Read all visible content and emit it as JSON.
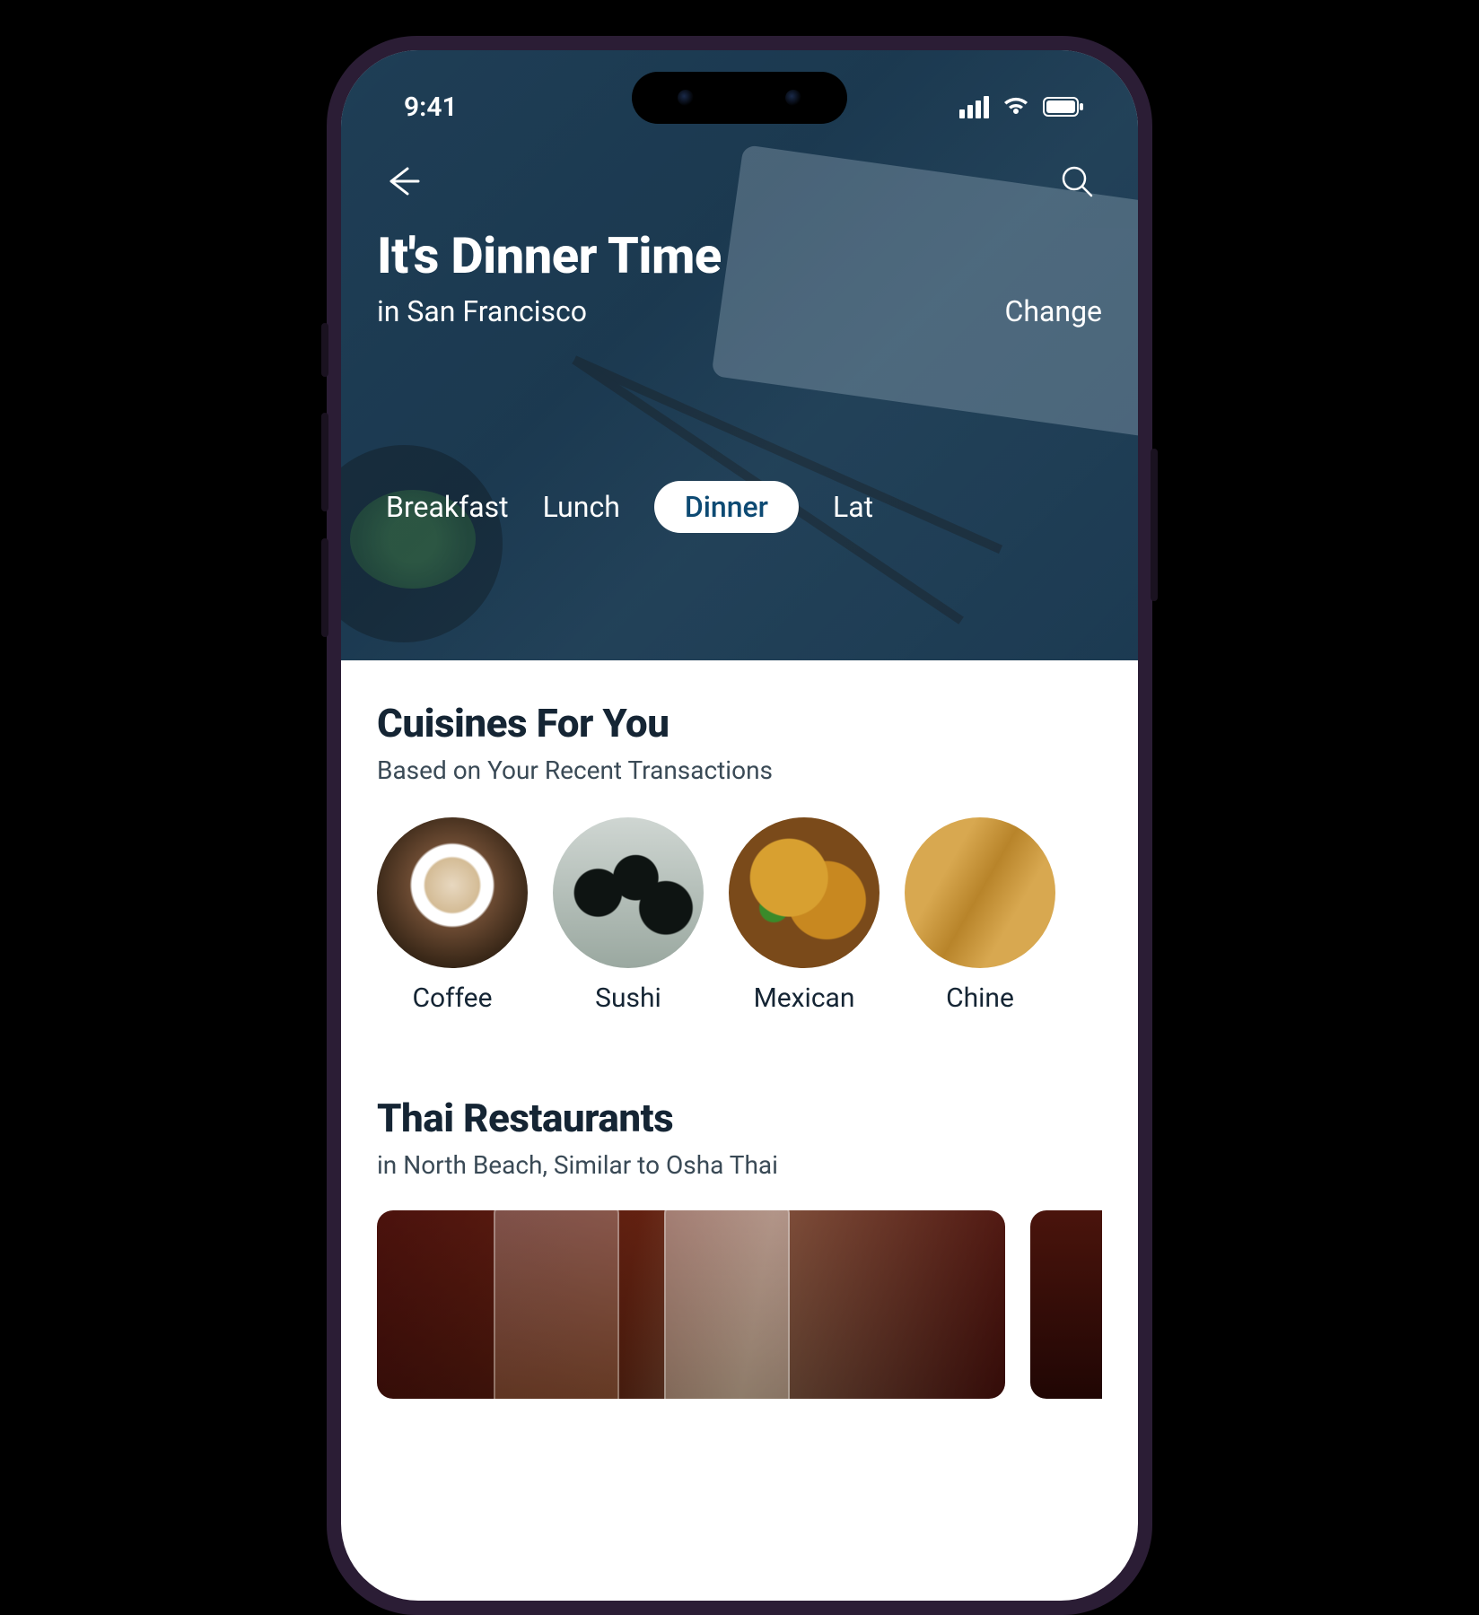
{
  "status": {
    "time": "9:41"
  },
  "hero": {
    "title": "It's Dinner Time",
    "location_prefix": "in San Francisco",
    "change_label": "Change",
    "tabs": [
      {
        "label": "Breakfast",
        "active": false
      },
      {
        "label": "Lunch",
        "active": false
      },
      {
        "label": "Dinner",
        "active": true
      },
      {
        "label": "Lat",
        "active": false
      }
    ]
  },
  "cuisines": {
    "title": "Cuisines For You",
    "subtitle": "Based on Your Recent Transactions",
    "items": [
      {
        "label": "Coffee"
      },
      {
        "label": "Sushi"
      },
      {
        "label": "Mexican"
      },
      {
        "label": "Chine"
      }
    ]
  },
  "restaurants": {
    "title": "Thai Restaurants",
    "subtitle": "in North Beach, Similar to Osha Thai"
  }
}
